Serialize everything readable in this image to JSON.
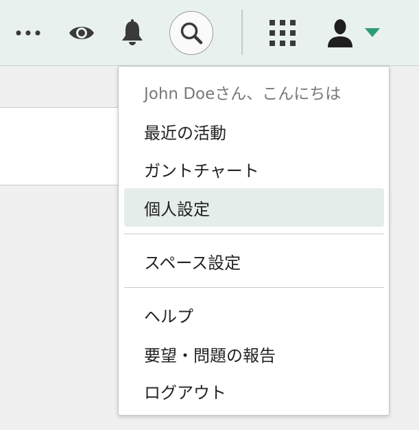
{
  "header": {
    "icons": {
      "more": "more-dots-icon",
      "watch": "eye-icon",
      "notifications": "bell-icon",
      "search": "search-icon",
      "apps": "apps-grid-icon",
      "user": "user-icon",
      "caret": "caret-down-icon"
    },
    "colors": {
      "background": "#e9f1ee",
      "icon": "#3a3a3a",
      "accent": "#2e9b78"
    }
  },
  "user_menu": {
    "greeting": "John Doeさん、こんにちは",
    "items": [
      {
        "label": "最近の活動"
      },
      {
        "label": "ガントチャート"
      },
      {
        "label": "個人設定",
        "active": true
      },
      {
        "label": "スペース設定"
      },
      {
        "label": "ヘルプ"
      },
      {
        "label": "要望・問題の報告"
      },
      {
        "label": "ログアウト"
      }
    ],
    "colors": {
      "active_background": "#e4ede9",
      "greeting_text": "#777777"
    }
  }
}
